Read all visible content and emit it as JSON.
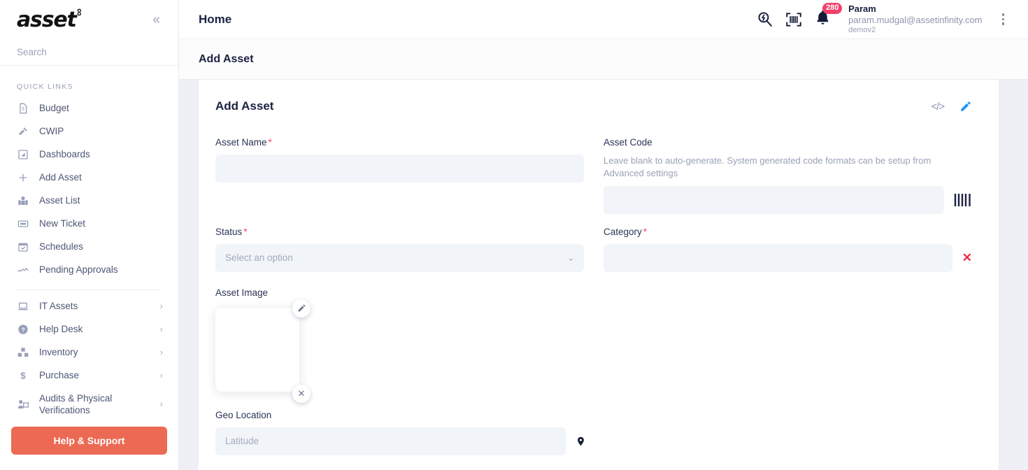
{
  "sidebar": {
    "logo": {
      "text": "asset",
      "superscript": "∞"
    },
    "collapse_icon": "chevron-double-left",
    "search": {
      "placeholder": "Search",
      "value": ""
    },
    "quick_links_heading": "QUICK LINKS",
    "quick_links": [
      {
        "label": "Budget",
        "icon": "budget-document-icon"
      },
      {
        "label": "CWIP",
        "icon": "hammer-icon"
      },
      {
        "label": "Dashboards",
        "icon": "dashboard-icon"
      },
      {
        "label": "Add Asset",
        "icon": "plus-icon"
      },
      {
        "label": "Asset List",
        "icon": "asset-list-icon"
      },
      {
        "label": "New Ticket",
        "icon": "ticket-icon"
      },
      {
        "label": "Schedules",
        "icon": "calendar-check-icon"
      },
      {
        "label": "Pending Approvals",
        "icon": "signature-icon"
      }
    ],
    "modules": [
      {
        "label": "IT Assets",
        "icon": "laptop-icon",
        "chevron": "›"
      },
      {
        "label": "Help Desk",
        "icon": "help-circle-icon",
        "chevron": "›"
      },
      {
        "label": "Inventory",
        "icon": "boxes-icon",
        "chevron": "›"
      },
      {
        "label": "Purchase",
        "icon": "dollar-icon",
        "chevron": "›"
      },
      {
        "label": "Audits & Physical Verifications",
        "icon": "audit-icon",
        "chevron": "›"
      }
    ],
    "help_button": "Help & Support"
  },
  "topbar": {
    "title": "Home",
    "quick_search_icon": "search-bolt-icon",
    "scanner_icon": "barcode-scanner-icon",
    "bell_icon": "bell-icon",
    "notification_count": "280",
    "user": {
      "name": "Param",
      "email": "param.mudgal@assetinfinity.com",
      "org": "demov2"
    },
    "menu_icon": "kebab-menu-icon"
  },
  "subbar": {
    "title": "Add Asset"
  },
  "card": {
    "title": "Add Asset",
    "code_icon": "</>",
    "edit_icon": "pencil-icon",
    "fields": {
      "asset_name": {
        "label": "Asset Name",
        "required": true,
        "value": "",
        "placeholder": ""
      },
      "asset_code": {
        "label": "Asset Code",
        "required": false,
        "hint": "Leave blank to auto-generate. System generated code formats can be setup from Advanced settings",
        "value": "",
        "placeholder": "",
        "action_icon": "barcode-icon"
      },
      "status": {
        "label": "Status",
        "required": true,
        "value": "",
        "placeholder": "Select an option",
        "chevron": "⌄"
      },
      "category": {
        "label": "Category",
        "required": true,
        "value": "",
        "placeholder": "",
        "clear_icon": "✕"
      },
      "asset_image": {
        "label": "Asset Image",
        "edit_icon": "pencil-icon",
        "remove_icon": "✕"
      },
      "geo_location": {
        "label": "Geo Location",
        "value": "",
        "placeholder": "Latitude",
        "pin_icon": "map-pin-icon"
      }
    }
  },
  "colors": {
    "accent_coral": "#ec6a53",
    "accent_blue": "#2196f3",
    "required_red": "#f53f6b",
    "badge_pink": "#f53f6b",
    "input_bg": "#f1f4f8",
    "text_dark": "#1b2240"
  }
}
